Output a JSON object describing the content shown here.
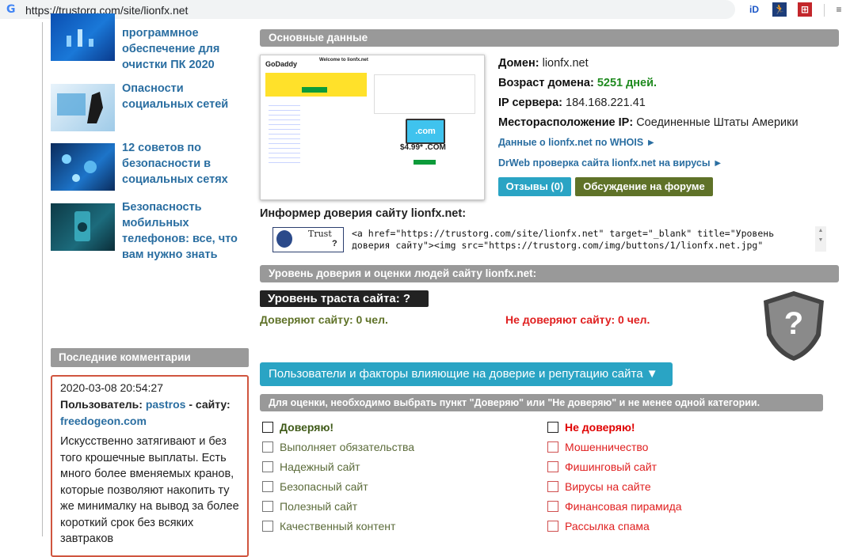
{
  "browser": {
    "url": "https://trustorg.com/site/lionfx.net",
    "extensions": [
      "iD",
      "🏃",
      "⊞",
      "≡"
    ]
  },
  "sidebar": {
    "articles": [
      {
        "title": "программное обеспечение для очистки ПК 2020"
      },
      {
        "title": "Опасности социальных сетей"
      },
      {
        "title": "12 советов по безопасности в социальных сетях"
      },
      {
        "title": "Безопасность мобильных телефонов: все, что вам нужно знать"
      }
    ],
    "comments_title": "Последние комментарии",
    "comment": {
      "date": "2020-03-08 20:54:27",
      "user_label": "Пользователь:",
      "user": "pastros",
      "site_label": "- сайту:",
      "site": "freedogeon.com",
      "text": "Искусственно затягивают и без того крошечные выплаты. Есть много более вменяемых кранов, которые позволяют накопить ту же минималку на вывод за более короткий срок без всяких завтраков"
    }
  },
  "main": {
    "basic_title": "Основные данные",
    "screenshot": {
      "brand": "GoDaddy",
      "welcome": "Welcome to lionfx.net",
      "price": "$4.99* .COM",
      "com": ".com"
    },
    "domain_label": "Домен:",
    "domain": "lionfx.net",
    "age_label": "Возраст домена:",
    "age": "5251 дней.",
    "ip_label": "IP сервера:",
    "ip": "184.168.221.41",
    "loc_label": "Месторасположение IP:",
    "loc": "Соединенные Штаты Америки",
    "whois_link": "Данные о lionfx.net по WHOIS ►",
    "drweb_link": "DrWeb проверка сайта lionfx.net на вирусы ►",
    "reviews_btn": "Отзывы (0)",
    "forum_btn": "Обсуждение на форуме",
    "informer_title": "Информер доверия сайту lionfx.net:",
    "badge_text": "Trust",
    "badge_q": "?",
    "code_line1": "<a href=\"https://trustorg.com/site/lionfx.net\" target=\"_blank\" title=\"Уровень",
    "code_line2": "доверия сайту\"><img src=\"https://trustorg.com/img/buttons/1/lionfx.net.jpg\"",
    "trust_section_title": "Уровень доверия и оценки людей сайту lionfx.net:",
    "trust_level": "Уровень траста сайта: ?",
    "trust_yes": "Доверяют сайту: 0 чел.",
    "trust_no": "Не доверяют сайту: 0 чел.",
    "shield_symbol": "?",
    "users_factors_btn": "Пользователи и факторы влияющие на доверие и репутацию сайта ▼",
    "instruction": "Для оценки, необходимо выбрать пункт \"Доверяю\" или \"Не доверяю\" и не менее одной категории.",
    "trust_options": [
      "Доверяю!",
      "Выполняет обязательства",
      "Надежный сайт",
      "Безопасный сайт",
      "Полезный сайт",
      "Качественный контент"
    ],
    "distrust_options": [
      "Не доверяю!",
      "Мошенничество",
      "Фишинговый сайт",
      "Вирусы на сайте",
      "Финансовая пирамида",
      "Рассылка спама"
    ]
  }
}
